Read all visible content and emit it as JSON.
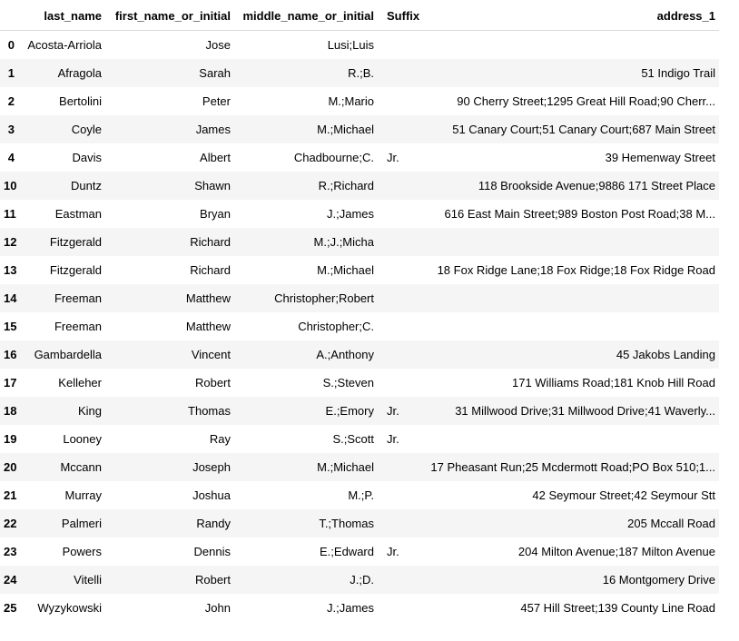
{
  "table": {
    "index_header": "",
    "columns": [
      "last_name",
      "first_name_or_initial",
      "middle_name_or_initial",
      "Suffix",
      "address_1"
    ],
    "rows": [
      {
        "index": "0",
        "last_name": "Acosta-Arriola",
        "first_name_or_initial": "Jose",
        "middle_name_or_initial": "Lusi;Luis",
        "Suffix": "",
        "address_1": ""
      },
      {
        "index": "1",
        "last_name": "Afragola",
        "first_name_or_initial": "Sarah",
        "middle_name_or_initial": "R.;B.",
        "Suffix": "",
        "address_1": "51 Indigo Trail"
      },
      {
        "index": "2",
        "last_name": "Bertolini",
        "first_name_or_initial": "Peter",
        "middle_name_or_initial": "M.;Mario",
        "Suffix": "",
        "address_1": "90 Cherry Street;1295 Great Hill Road;90 Cherr..."
      },
      {
        "index": "3",
        "last_name": "Coyle",
        "first_name_or_initial": "James",
        "middle_name_or_initial": "M.;Michael",
        "Suffix": "",
        "address_1": "51 Canary Court;51 Canary Court;687 Main Street"
      },
      {
        "index": "4",
        "last_name": "Davis",
        "first_name_or_initial": "Albert",
        "middle_name_or_initial": "Chadbourne;C.",
        "Suffix": "Jr.",
        "address_1": "39 Hemenway Street"
      },
      {
        "index": "10",
        "last_name": "Duntz",
        "first_name_or_initial": "Shawn",
        "middle_name_or_initial": "R.;Richard",
        "Suffix": "",
        "address_1": "118 Brookside Avenue;9886 171 Street Place"
      },
      {
        "index": "11",
        "last_name": "Eastman",
        "first_name_or_initial": "Bryan",
        "middle_name_or_initial": "J.;James",
        "Suffix": "",
        "address_1": "616 East Main Street;989 Boston Post Road;38 M..."
      },
      {
        "index": "12",
        "last_name": "Fitzgerald",
        "first_name_or_initial": "Richard",
        "middle_name_or_initial": "M.;J.;Micha",
        "Suffix": "",
        "address_1": ""
      },
      {
        "index": "13",
        "last_name": "Fitzgerald",
        "first_name_or_initial": "Richard",
        "middle_name_or_initial": "M.;Michael",
        "Suffix": "",
        "address_1": "18 Fox Ridge Lane;18 Fox Ridge;18 Fox Ridge Road"
      },
      {
        "index": "14",
        "last_name": "Freeman",
        "first_name_or_initial": "Matthew",
        "middle_name_or_initial": "Christopher;Robert",
        "Suffix": "",
        "address_1": ""
      },
      {
        "index": "15",
        "last_name": "Freeman",
        "first_name_or_initial": "Matthew",
        "middle_name_or_initial": "Christopher;C.",
        "Suffix": "",
        "address_1": ""
      },
      {
        "index": "16",
        "last_name": "Gambardella",
        "first_name_or_initial": "Vincent",
        "middle_name_or_initial": "A.;Anthony",
        "Suffix": "",
        "address_1": "45 Jakobs Landing"
      },
      {
        "index": "17",
        "last_name": "Kelleher",
        "first_name_or_initial": "Robert",
        "middle_name_or_initial": "S.;Steven",
        "Suffix": "",
        "address_1": "171 Williams Road;181 Knob Hill Road"
      },
      {
        "index": "18",
        "last_name": "King",
        "first_name_or_initial": "Thomas",
        "middle_name_or_initial": "E.;Emory",
        "Suffix": "Jr.",
        "address_1": "31 Millwood Drive;31 Millwood Drive;41 Waverly..."
      },
      {
        "index": "19",
        "last_name": "Looney",
        "first_name_or_initial": "Ray",
        "middle_name_or_initial": "S.;Scott",
        "Suffix": "Jr.",
        "address_1": ""
      },
      {
        "index": "20",
        "last_name": "Mccann",
        "first_name_or_initial": "Joseph",
        "middle_name_or_initial": "M.;Michael",
        "Suffix": "",
        "address_1": "17 Pheasant Run;25 Mcdermott Road;PO Box 510;1..."
      },
      {
        "index": "21",
        "last_name": "Murray",
        "first_name_or_initial": "Joshua",
        "middle_name_or_initial": "M.;P.",
        "Suffix": "",
        "address_1": "42 Seymour Street;42 Seymour Stt"
      },
      {
        "index": "22",
        "last_name": "Palmeri",
        "first_name_or_initial": "Randy",
        "middle_name_or_initial": "T.;Thomas",
        "Suffix": "",
        "address_1": "205 Mccall Road"
      },
      {
        "index": "23",
        "last_name": "Powers",
        "first_name_or_initial": "Dennis",
        "middle_name_or_initial": "E.;Edward",
        "Suffix": "Jr.",
        "address_1": "204 Milton Avenue;187 Milton Avenue"
      },
      {
        "index": "24",
        "last_name": "Vitelli",
        "first_name_or_initial": "Robert",
        "middle_name_or_initial": "J.;D.",
        "Suffix": "",
        "address_1": "16 Montgomery Drive"
      },
      {
        "index": "25",
        "last_name": "Wyzykowski",
        "first_name_or_initial": "John",
        "middle_name_or_initial": "J.;James",
        "Suffix": "",
        "address_1": "457 Hill Street;139 County Line Road"
      }
    ]
  },
  "style": {
    "stripe_color": "#f5f5f5",
    "base_color": "#ffffff",
    "text_color": "#000000",
    "rule_color": "#d9d9d9"
  }
}
